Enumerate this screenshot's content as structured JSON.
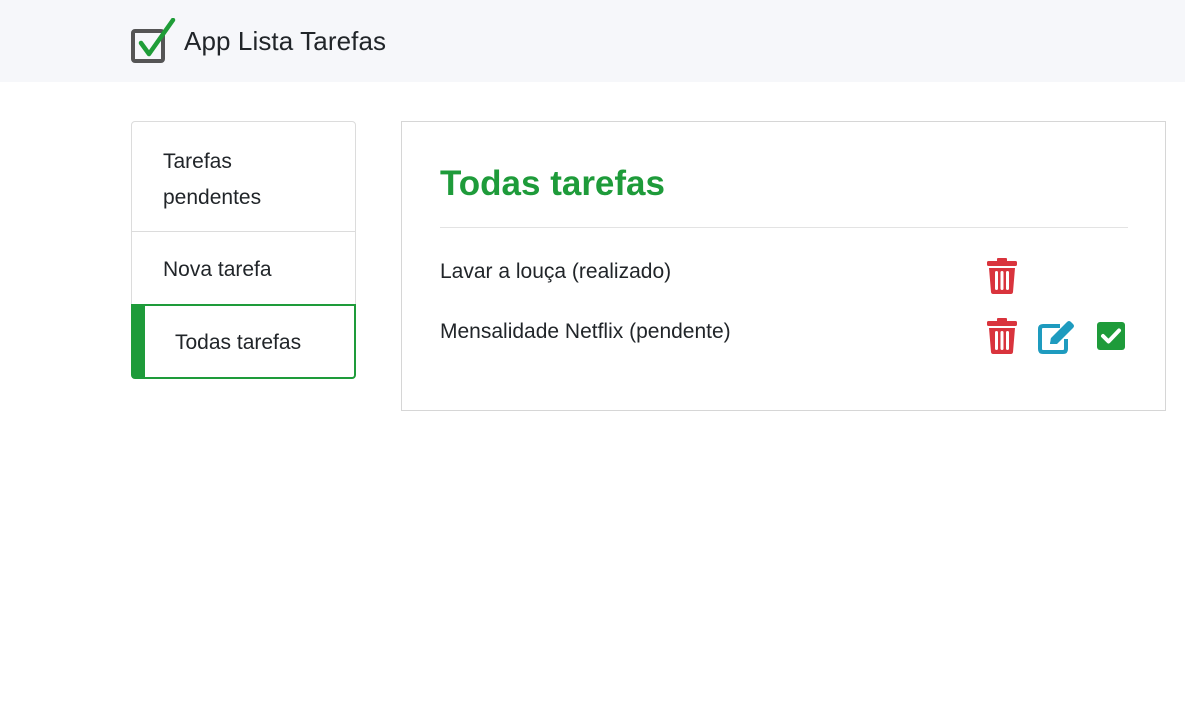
{
  "app": {
    "title": "App Lista Tarefas",
    "logo_icon": "checkbox-check-icon",
    "colors": {
      "accent_green": "#1e9b3a",
      "delete_red": "#d9343d",
      "edit_teal": "#1e9bbf",
      "navbar_bg": "#f6f7fa"
    }
  },
  "sidebar": {
    "items": [
      {
        "label": "Tarefas pendentes",
        "active": false
      },
      {
        "label": "Nova tarefa",
        "active": false
      },
      {
        "label": "Todas tarefas",
        "active": true
      }
    ]
  },
  "main": {
    "title": "Todas tarefas",
    "tasks": [
      {
        "text": "Lavar a louça (realizado)",
        "actions": [
          "trash-icon"
        ]
      },
      {
        "text": "Mensalidade Netflix (pendente)",
        "actions": [
          "trash-icon",
          "edit-icon",
          "check-square-icon"
        ]
      }
    ]
  }
}
